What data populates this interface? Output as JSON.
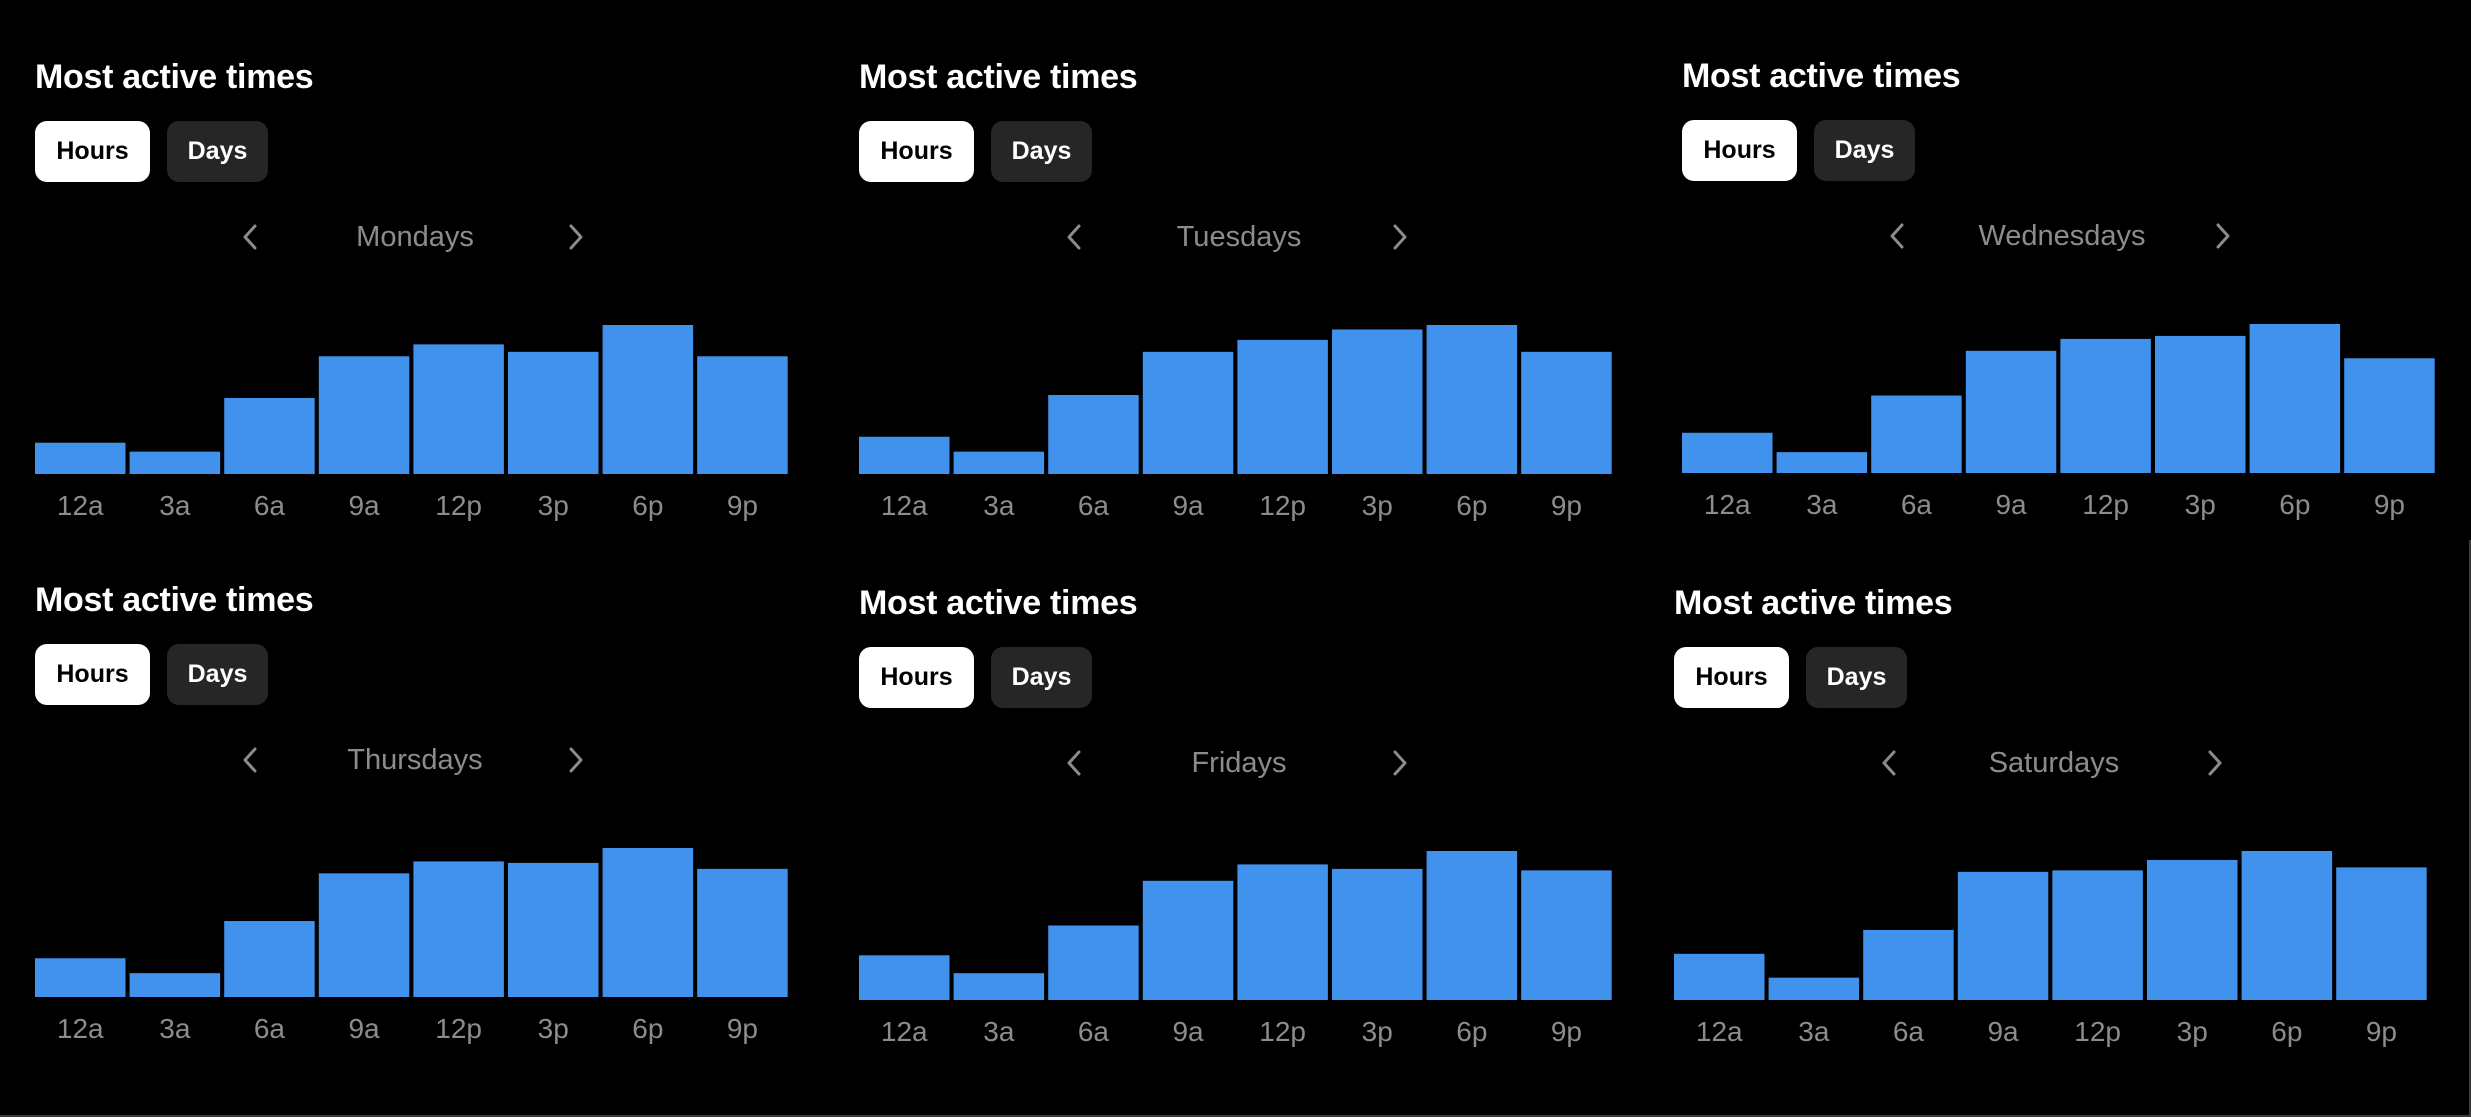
{
  "panels": [
    {
      "title": "Most active times",
      "toggle": {
        "hours": "Hours",
        "days": "Days",
        "selected": "Hours"
      },
      "day": "Mondays"
    },
    {
      "title": "Most active times",
      "toggle": {
        "hours": "Hours",
        "days": "Days",
        "selected": "Hours"
      },
      "day": "Tuesdays"
    },
    {
      "title": "Most active times",
      "toggle": {
        "hours": "Hours",
        "days": "Days",
        "selected": "Hours"
      },
      "day": "Wednesdays"
    },
    {
      "title": "Most active times",
      "toggle": {
        "hours": "Hours",
        "days": "Days",
        "selected": "Hours"
      },
      "day": "Thursdays"
    },
    {
      "title": "Most active times",
      "toggle": {
        "hours": "Hours",
        "days": "Days",
        "selected": "Hours"
      },
      "day": "Fridays"
    },
    {
      "title": "Most active times",
      "toggle": {
        "hours": "Hours",
        "days": "Days",
        "selected": "Hours"
      },
      "day": "Saturdays"
    }
  ],
  "icons": {
    "prev": "chevron-left-icon",
    "next": "chevron-right-icon"
  },
  "colors": {
    "bar": "#4192ec",
    "background": "#000000",
    "muted_text": "#8c8c8c",
    "inactive_button": "#262626"
  },
  "chart_data": [
    {
      "type": "bar",
      "title": "Most active times — Mondays",
      "categories": [
        "12a",
        "3a",
        "6a",
        "9a",
        "12p",
        "3p",
        "6p",
        "9p"
      ],
      "values": [
        21,
        15,
        51,
        79,
        87,
        82,
        100,
        79
      ],
      "xlabel": "",
      "ylabel": "",
      "ylim": [
        0,
        100
      ],
      "grid": false,
      "note": "relative activity, normalized to peak = 100"
    },
    {
      "type": "bar",
      "title": "Most active times — Tuesdays",
      "categories": [
        "12a",
        "3a",
        "6a",
        "9a",
        "12p",
        "3p",
        "6p",
        "9p"
      ],
      "values": [
        25,
        15,
        53,
        82,
        90,
        97,
        100,
        82
      ],
      "xlabel": "",
      "ylabel": "",
      "ylim": [
        0,
        100
      ],
      "grid": false,
      "note": "relative activity, normalized to peak = 100"
    },
    {
      "type": "bar",
      "title": "Most active times — Wednesdays",
      "categories": [
        "12a",
        "3a",
        "6a",
        "9a",
        "12p",
        "3p",
        "6p",
        "9p"
      ],
      "values": [
        27,
        14,
        52,
        82,
        90,
        92,
        100,
        77
      ],
      "xlabel": "",
      "ylabel": "",
      "ylim": [
        0,
        100
      ],
      "grid": false,
      "note": "relative activity, normalized to peak = 100"
    },
    {
      "type": "bar",
      "title": "Most active times — Thursdays",
      "categories": [
        "12a",
        "3a",
        "6a",
        "9a",
        "12p",
        "3p",
        "6p",
        "9p"
      ],
      "values": [
        26,
        16,
        51,
        83,
        91,
        90,
        100,
        86
      ],
      "xlabel": "",
      "ylabel": "",
      "ylim": [
        0,
        100
      ],
      "grid": false,
      "note": "relative activity, normalized to peak = 100"
    },
    {
      "type": "bar",
      "title": "Most active times — Fridays",
      "categories": [
        "12a",
        "3a",
        "6a",
        "9a",
        "12p",
        "3p",
        "6p",
        "9p"
      ],
      "values": [
        30,
        18,
        50,
        80,
        91,
        88,
        100,
        87
      ],
      "xlabel": "",
      "ylabel": "",
      "ylim": [
        0,
        100
      ],
      "grid": false,
      "note": "relative activity, normalized to peak = 100"
    },
    {
      "type": "bar",
      "title": "Most active times — Saturdays",
      "categories": [
        "12a",
        "3a",
        "6a",
        "9a",
        "12p",
        "3p",
        "6p",
        "9p"
      ],
      "values": [
        31,
        15,
        47,
        86,
        87,
        94,
        100,
        89
      ],
      "xlabel": "",
      "ylabel": "",
      "ylim": [
        0,
        100
      ],
      "grid": false,
      "note": "relative activity, normalized to peak = 100"
    }
  ]
}
